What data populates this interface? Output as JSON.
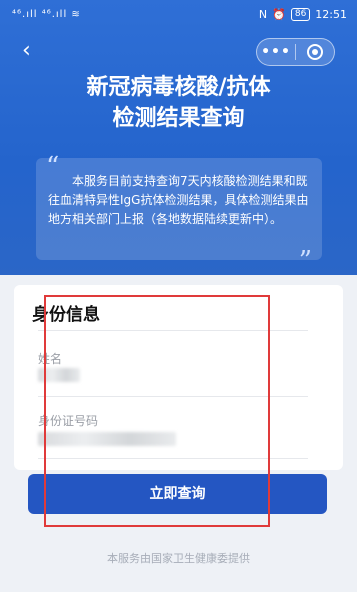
{
  "status_bar": {
    "signal_text": "⁴⁶.ıll ⁴⁶.ıll ≋",
    "nfc": "N",
    "alarm": "⏰",
    "battery": "86",
    "time": "12:51"
  },
  "nav": {
    "back_symbol": "‹",
    "more_symbol": "•••"
  },
  "header": {
    "title_line1": "新冠病毒核酸/抗体",
    "title_line2": "检测结果查询",
    "notice": "本服务目前支持查询7天内核酸检测结果和既往血清特异性IgG抗体检测结果，具体检测结果由地方相关部门上报（各地数据陆续更新中）。",
    "quote_open": "“",
    "quote_close": "”"
  },
  "form": {
    "section_title": "身份信息",
    "name_label": "姓名",
    "name_value": "",
    "id_label": "身份证号码",
    "id_value": "",
    "submit_label": "立即查询"
  },
  "footer": {
    "provider": "本服务由国家卫生健康委提供"
  },
  "colors": {
    "hero_blue": "#2464cc",
    "button_blue": "#2456c2",
    "highlight_red": "#e03a3a"
  }
}
